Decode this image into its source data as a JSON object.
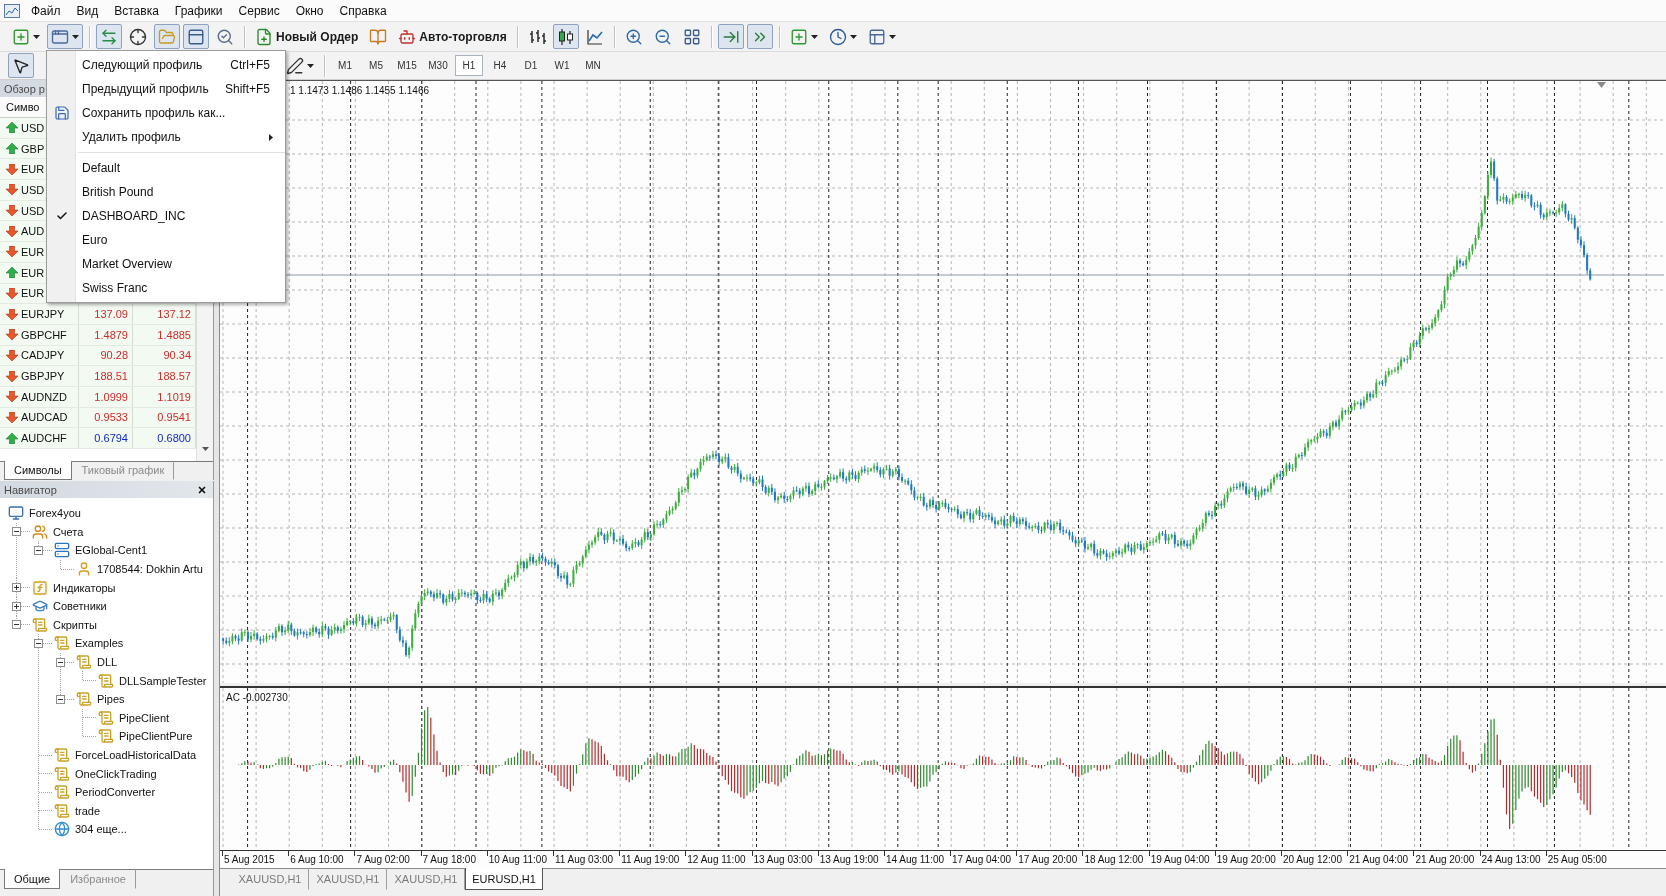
{
  "menu_bar": {
    "items": [
      "Файл",
      "Вид",
      "Вставка",
      "Графики",
      "Сервис",
      "Окно",
      "Справка"
    ]
  },
  "toolbar": {
    "groups": [
      [
        {
          "kind": "new-chart",
          "pressed": false
        },
        {
          "kind": "profiles",
          "pressed": true
        }
      ],
      [
        {
          "kind": "market-watch",
          "pressed": true
        },
        {
          "kind": "data-window",
          "pressed": false
        },
        {
          "kind": "navigator",
          "pressed": true
        },
        {
          "kind": "terminal",
          "pressed": true
        },
        {
          "kind": "tester",
          "pressed": false
        }
      ],
      [
        {
          "kind": "new-order",
          "label": "Новый Ордер",
          "pressed": false
        },
        {
          "kind": "meta-editor",
          "pressed": false
        },
        {
          "kind": "auto-trading",
          "label": "Авто-торговля",
          "pressed": false
        }
      ],
      [
        {
          "kind": "bar-chart",
          "pressed": false
        },
        {
          "kind": "candles",
          "pressed": true
        },
        {
          "kind": "line-chart",
          "pressed": false
        }
      ],
      [
        {
          "kind": "zoom-in",
          "pressed": false
        },
        {
          "kind": "zoom-out",
          "pressed": false
        },
        {
          "kind": "tile",
          "pressed": false
        }
      ],
      [
        {
          "kind": "chart-shift",
          "pressed": true
        },
        {
          "kind": "auto-scroll",
          "pressed": true
        }
      ],
      [
        {
          "kind": "indicators",
          "pressed": false
        },
        {
          "kind": "periods",
          "pressed": false
        },
        {
          "kind": "templates",
          "pressed": false
        }
      ]
    ]
  },
  "drawing_toolbar": [
    {
      "kind": "cursor",
      "pressed": true
    },
    {
      "kind": "shapes",
      "pressed": false
    }
  ],
  "timeframes": [
    {
      "label": "M1",
      "selected": false
    },
    {
      "label": "M5",
      "selected": false
    },
    {
      "label": "M15",
      "selected": false
    },
    {
      "label": "M30",
      "selected": false
    },
    {
      "label": "H1",
      "selected": true
    },
    {
      "label": "H4",
      "selected": false
    },
    {
      "label": "D1",
      "selected": false
    },
    {
      "label": "W1",
      "selected": false
    },
    {
      "label": "MN",
      "selected": false
    }
  ],
  "market_watch": {
    "title": "Обзор р",
    "columns": [
      "Симво"
    ],
    "rows": [
      {
        "symbol": "USD",
        "rising": true
      },
      {
        "symbol": "GBP",
        "rising": true
      },
      {
        "symbol": "EUR",
        "rising": false
      },
      {
        "symbol": "USD",
        "rising": false
      },
      {
        "symbol": "USD",
        "rising": false
      },
      {
        "symbol": "AUD",
        "rising": false
      },
      {
        "symbol": "EUR",
        "rising": false
      },
      {
        "symbol": "EUR",
        "rising": true
      },
      {
        "symbol": "EUR",
        "rising": false
      },
      {
        "symbol": "EURJPY",
        "rising": false,
        "bid": "137.09",
        "ask": "137.12"
      },
      {
        "symbol": "GBPCHF",
        "rising": false,
        "bid": "1.4879",
        "ask": "1.4885"
      },
      {
        "symbol": "CADJPY",
        "rising": false,
        "bid": "90.28",
        "ask": "90.34"
      },
      {
        "symbol": "GBPJPY",
        "rising": false,
        "bid": "188.51",
        "ask": "188.57"
      },
      {
        "symbol": "AUDNZD",
        "rising": false,
        "bid": "1.0999",
        "ask": "1.1019"
      },
      {
        "symbol": "AUDCAD",
        "rising": false,
        "bid": "0.9533",
        "ask": "0.9541"
      },
      {
        "symbol": "AUDCHF",
        "rising": true,
        "bid": "0.6794",
        "ask": "0.6800"
      }
    ],
    "tabs": [
      {
        "label": "Символы",
        "selected": true
      },
      {
        "label": "Тиковый график",
        "selected": false
      }
    ]
  },
  "navigator": {
    "title": "Навигатор",
    "tree": [
      {
        "label": "Forex4you",
        "kind": "root",
        "children": [
          {
            "label": "Счета",
            "kind": "accounts",
            "expanded": true,
            "children": [
              {
                "label": "EGlobal-Cent1",
                "kind": "server",
                "expanded": true,
                "children": [
                  {
                    "label": "1708544: Dokhin Artu",
                    "kind": "account"
                  }
                ]
              }
            ]
          },
          {
            "label": "Индикаторы",
            "kind": "indicators",
            "expanded": false
          },
          {
            "label": "Советники",
            "kind": "experts",
            "expanded": false
          },
          {
            "label": "Скрипты",
            "kind": "script",
            "expanded": true,
            "children": [
              {
                "label": "Examples",
                "kind": "script",
                "expanded": true,
                "children": [
                  {
                    "label": "DLL",
                    "kind": "script",
                    "expanded": true,
                    "children": [
                      {
                        "label": "DLLSampleTester",
                        "kind": "script"
                      }
                    ]
                  },
                  {
                    "label": "Pipes",
                    "kind": "script",
                    "expanded": true,
                    "children": [
                      {
                        "label": "PipeClient",
                        "kind": "script"
                      },
                      {
                        "label": "PipeClientPure",
                        "kind": "script"
                      }
                    ]
                  }
                ]
              },
              {
                "label": "ForceLoadHistoricalData",
                "kind": "script"
              },
              {
                "label": "OneClickTrading",
                "kind": "script"
              },
              {
                "label": "PeriodConverter",
                "kind": "script"
              },
              {
                "label": "trade",
                "kind": "script"
              },
              {
                "label": "304 еще...",
                "kind": "more"
              }
            ]
          }
        ]
      }
    ],
    "tabs": [
      {
        "label": "Общие",
        "selected": true
      },
      {
        "label": "Избранное",
        "selected": false
      }
    ]
  },
  "chart": {
    "readout": "1 1.1473 1.1486 1.1455 1.1466",
    "indicator_label": "AC -0.002730",
    "time_axis": [
      "5 Aug 2015",
      "6 Aug 10:00",
      "7 Aug 02:00",
      "7 Aug 18:00",
      "10 Aug 11:00",
      "11 Aug 03:00",
      "11 Aug 19:00",
      "12 Aug 11:00",
      "13 Aug 03:00",
      "13 Aug 19:00",
      "14 Aug 11:00",
      "17 Aug 04:00",
      "17 Aug 20:00",
      "18 Aug 12:00",
      "19 Aug 04:00",
      "19 Aug 20:00",
      "20 Aug 12:00",
      "21 Aug 04:00",
      "21 Aug 20:00",
      "24 Aug 13:00",
      "25 Aug 05:00"
    ]
  },
  "chart_tabs": [
    {
      "label": "XAUUSD,H1",
      "selected": false
    },
    {
      "label": "XAUUSD,H1",
      "selected": false
    },
    {
      "label": "XAUUSD,H1",
      "selected": false
    },
    {
      "label": "EURUSD,H1",
      "selected": true
    }
  ],
  "profiles_menu": {
    "items": [
      {
        "kind": "command",
        "label": "Следующий профиль",
        "shortcut": "Ctrl+F5"
      },
      {
        "kind": "command",
        "label": "Предыдущий профиль",
        "shortcut": "Shift+F5"
      },
      {
        "kind": "save",
        "label": "Сохранить профиль как..."
      },
      {
        "kind": "submenu",
        "label": "Удалить профиль"
      },
      {
        "kind": "separator"
      },
      {
        "kind": "profile",
        "label": "Default",
        "checked": false
      },
      {
        "kind": "profile",
        "label": "British Pound",
        "checked": false
      },
      {
        "kind": "profile",
        "label": "DASHBOARD_INC",
        "checked": true
      },
      {
        "kind": "profile",
        "label": "Euro",
        "checked": false
      },
      {
        "kind": "profile",
        "label": "Market Overview",
        "checked": false
      },
      {
        "kind": "profile",
        "label": "Swiss Franc",
        "checked": false
      }
    ]
  }
}
